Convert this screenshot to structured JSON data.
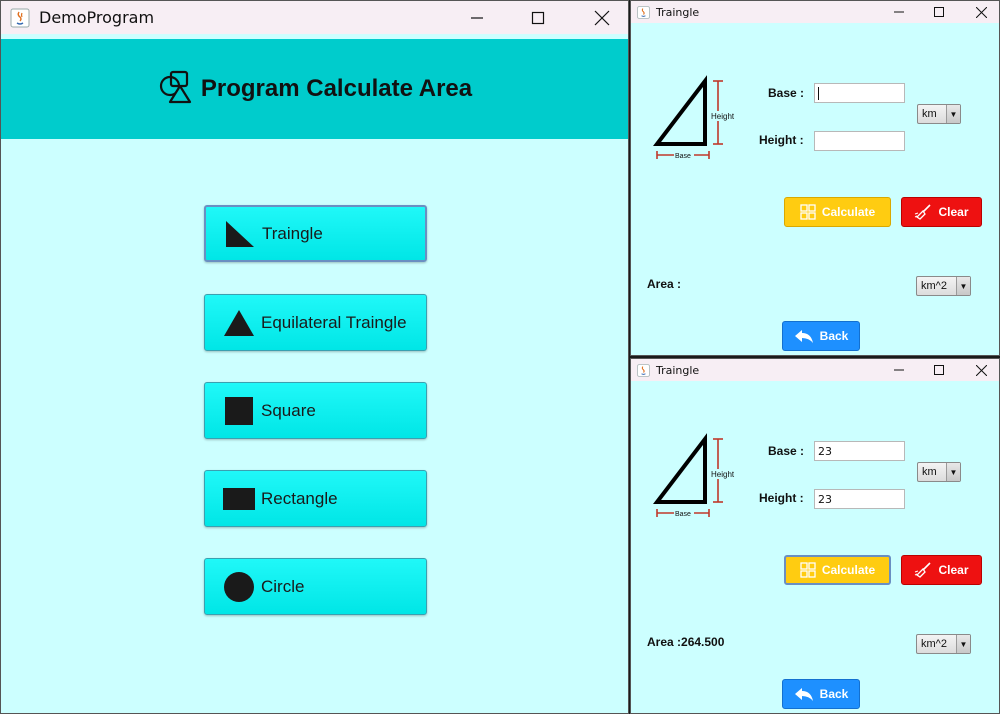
{
  "main_window": {
    "title": "DemoProgram",
    "header": "Program Calculate Area",
    "buttons": [
      {
        "label": "Traingle",
        "icon": "right-triangle-icon"
      },
      {
        "label": "Equilateral Traingle",
        "icon": "triangle-icon"
      },
      {
        "label": "Square",
        "icon": "square-icon"
      },
      {
        "label": "Rectangle",
        "icon": "rectangle-icon"
      },
      {
        "label": "Circle",
        "icon": "circle-icon"
      }
    ]
  },
  "triangle_windows": [
    {
      "title": "Traingle",
      "figure": {
        "height_label": "Height",
        "base_label": "Base"
      },
      "base_label": "Base :",
      "base_value": "",
      "height_label": "Height :",
      "height_value": "",
      "unit": "km",
      "calculate_label": "Calculate",
      "clear_label": "Clear",
      "area_label": "Area :",
      "area_value": "",
      "area_unit": "km^2",
      "back_label": "Back"
    },
    {
      "title": "Traingle",
      "figure": {
        "height_label": "Height",
        "base_label": "Base"
      },
      "base_label": "Base :",
      "base_value": "23",
      "height_label": "Height :",
      "height_value": "23",
      "unit": "km",
      "calculate_label": "Calculate",
      "clear_label": "Clear",
      "area_label": "Area :",
      "area_value": "264.500",
      "area_unit": "km^2",
      "back_label": "Back"
    }
  ],
  "colors": {
    "window_bg": "#ccffff",
    "header_bg": "#00cccc",
    "button_cyan": "#00eeee",
    "calculate_yellow": "#ffcc11",
    "clear_red": "#ee1111",
    "back_blue": "#1e90ff"
  }
}
